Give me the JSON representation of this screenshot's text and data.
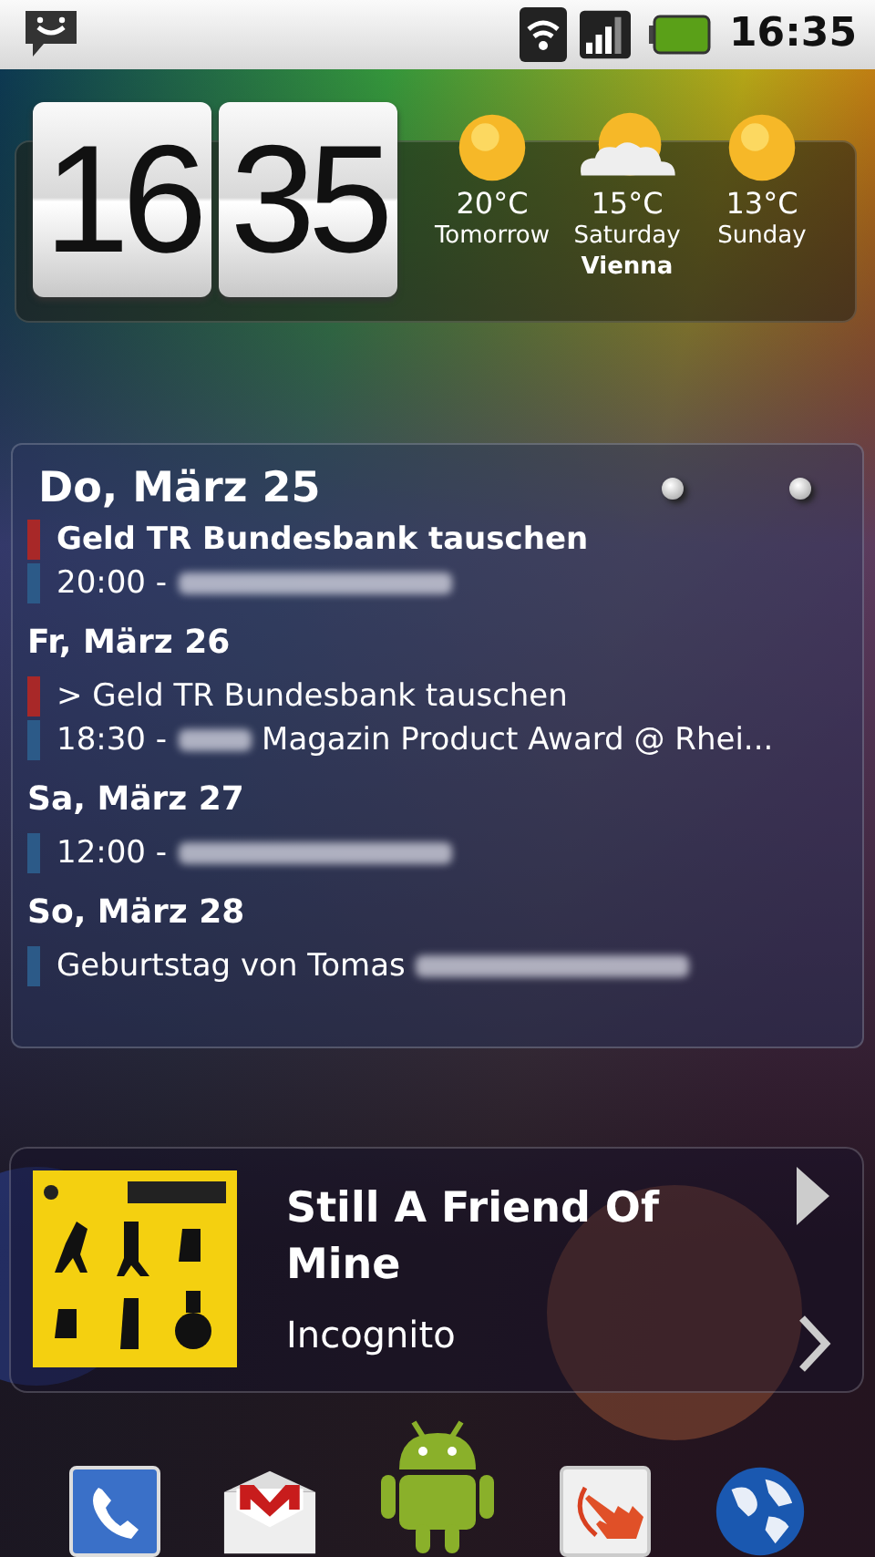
{
  "status_bar": {
    "time": "16:35"
  },
  "clock": {
    "hours": "16",
    "minutes": "35"
  },
  "weather": {
    "days": [
      {
        "temp": "20°C",
        "day": "Tomorrow",
        "kind": "sun"
      },
      {
        "temp": "15°C",
        "day": "Saturday",
        "kind": "cloud"
      },
      {
        "temp": "13°C",
        "day": "Sunday",
        "kind": "sun"
      }
    ],
    "city": "Vienna"
  },
  "calendar": {
    "title": "Do, März 25",
    "days": [
      {
        "lines": [
          {
            "text": "Geld TR Bundesbank tauschen",
            "bold": true,
            "color": "#a82828",
            "redacted": false
          },
          {
            "text": "20:00 -",
            "bold": false,
            "color": "#2c5a88",
            "redacted": true
          }
        ]
      },
      {
        "heading": "Fr, März 26",
        "lines": [
          {
            "text": "> Geld TR Bundesbank tauschen",
            "bold": false,
            "color": "#a82828",
            "redacted": false
          },
          {
            "text": "18:30 -",
            "bold": false,
            "color": "#2c5a88",
            "redacted": true,
            "text_after": "Magazin Product Award @ Rhei..."
          }
        ]
      },
      {
        "heading": "Sa, März 27",
        "lines": [
          {
            "text": "12:00 -",
            "bold": false,
            "color": "#2c5a88",
            "redacted": true
          }
        ]
      },
      {
        "heading": "So, März 28",
        "lines": [
          {
            "text": "Geburtstag von Tomas",
            "bold": false,
            "color": "#2c5a88",
            "redacted": true
          }
        ]
      }
    ]
  },
  "music": {
    "title": "Still A Friend Of Mine",
    "artist": "Incognito"
  },
  "dock": [
    {
      "kind": "phone"
    },
    {
      "kind": "mail"
    },
    {
      "kind": "robot"
    },
    {
      "kind": "hand"
    },
    {
      "kind": "globe"
    }
  ]
}
